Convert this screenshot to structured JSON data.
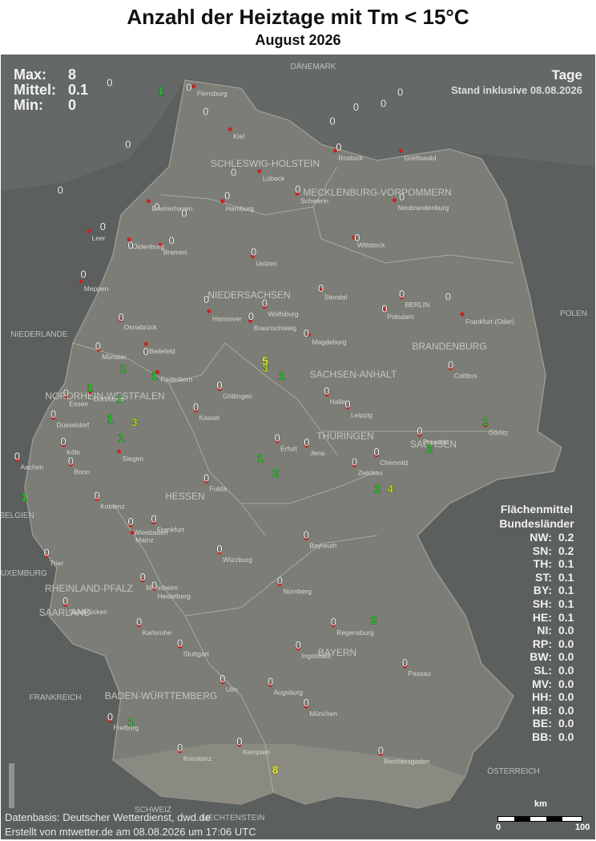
{
  "title": "Anzahl der Heiztage mit Tm < 15°C",
  "subtitle": "August 2026",
  "stats": [
    {
      "label": "Max:",
      "value": "8"
    },
    {
      "label": "Mittel:",
      "value": "0.1"
    },
    {
      "label": "Min:",
      "value": "0"
    }
  ],
  "unit": "Tage",
  "stand": "Stand inklusive 08.08.2026",
  "legend_means": {
    "heading1": "Flächenmittel",
    "heading2": "Bundesländer",
    "rows": [
      {
        "state": "NW:",
        "value": "0.2"
      },
      {
        "state": "SN:",
        "value": "0.2"
      },
      {
        "state": "TH:",
        "value": "0.1"
      },
      {
        "state": "ST:",
        "value": "0.1"
      },
      {
        "state": "BY:",
        "value": "0.1"
      },
      {
        "state": "SH:",
        "value": "0.1"
      },
      {
        "state": "HE:",
        "value": "0.1"
      },
      {
        "state": "NI:",
        "value": "0.0"
      },
      {
        "state": "RP:",
        "value": "0.0"
      },
      {
        "state": "BW:",
        "value": "0.0"
      },
      {
        "state": "SL:",
        "value": "0.0"
      },
      {
        "state": "MV:",
        "value": "0.0"
      },
      {
        "state": "HH:",
        "value": "0.0"
      },
      {
        "state": "HB:",
        "value": "0.0"
      },
      {
        "state": "BE:",
        "value": "0.0"
      },
      {
        "state": "BB:",
        "value": "0.0"
      }
    ]
  },
  "footer": {
    "source": "Datenbasis: Deutscher Wetterdienst, dwd.de",
    "created": "Erstellt von mtwetter.de am 08.08.2026 um 17:06 UTC"
  },
  "scalebar": {
    "unit": "km",
    "start": "0",
    "end": "100"
  },
  "colors": {
    "value_zero": "#ffffff",
    "value_low": "#22cc22",
    "value_mid": "#aadd22",
    "value_high": "#eeee22",
    "city_dot": "#cc2222"
  },
  "region_labels": [
    "SCHLESWIG-HOLSTEIN",
    "MECKLENBURG-VORPOMMERN",
    "NIEDERSACHSEN",
    "BRANDENBURG",
    "SACHSEN-ANHALT",
    "NORDRHEIN-WESTFALEN",
    "THÜRINGEN",
    "SACHSEN",
    "HESSEN",
    "RHEINLAND-PFALZ",
    "SAARLAND",
    "BAYERN",
    "BADEN-WÜRTTEMBERG"
  ],
  "country_labels": [
    "DÄNEMARK",
    "POLEN",
    "NIEDERLANDE",
    "BELGIEN",
    "LUXEMBURG",
    "FRANKREICH",
    "ÖSTERREICH",
    "SCHWEIZ",
    "LIECHTENSTEIN"
  ],
  "cities": [
    "Flensburg",
    "Kiel",
    "Lübeck",
    "Rostock",
    "Greifswald",
    "Schwerin",
    "Neubrandenburg",
    "Hamburg",
    "Bremerhaven",
    "Bremen",
    "Oldenburg",
    "Leer",
    "Uelzen",
    "Wittstock",
    "Meppen",
    "Stendal",
    "Potsdam",
    "BERLIN",
    "Frankfurt (Oder)",
    "Hannover",
    "Wolfsburg",
    "Braunschweig",
    "Magdeburg",
    "Osnabrück",
    "Münster",
    "Bielefeld",
    "Paderborn",
    "Göttingen",
    "Halle",
    "Leipzig",
    "Cottbus",
    "Dortmund",
    "Essen",
    "Düsseldorf",
    "Kassel",
    "Erfurt",
    "Jena",
    "Dresden",
    "Görlitz",
    "Chemnitz",
    "Zwickau",
    "Köln",
    "Bonn",
    "Aachen",
    "Siegen",
    "Fulda",
    "Koblenz",
    "Wiesbaden",
    "Frankfurt",
    "Mainz",
    "Würzburg",
    "Bayreuth",
    "Trier",
    "Mannheim",
    "Heidelberg",
    "Nürnberg",
    "Saarbrücken",
    "Karlsruhe",
    "Regensburg",
    "Stuttgart",
    "Ingolstadt",
    "Passau",
    "Ulm",
    "Augsburg",
    "München",
    "Freiburg",
    "Kempten",
    "Konstanz",
    "Berchtesgaden"
  ],
  "stations": [
    {
      "lon": 7.84,
      "lat": 54.78,
      "v": 0
    },
    {
      "lon": 8.81,
      "lat": 54.69,
      "v": 1
    },
    {
      "lon": 9.35,
      "lat": 54.73,
      "v": 0
    },
    {
      "lon": 13.37,
      "lat": 54.68,
      "v": 0
    },
    {
      "lon": 13.05,
      "lat": 54.56,
      "v": 0
    },
    {
      "lon": 9.67,
      "lat": 54.47,
      "v": 0
    },
    {
      "lon": 12.53,
      "lat": 54.52,
      "v": 0
    },
    {
      "lon": 12.08,
      "lat": 54.37,
      "v": 0
    },
    {
      "lon": 8.19,
      "lat": 54.12,
      "v": 0
    },
    {
      "lon": 6.9,
      "lat": 53.63,
      "v": 0
    },
    {
      "lon": 12.2,
      "lat": 54.09,
      "v": 0
    },
    {
      "lon": 13.4,
      "lat": 53.56,
      "v": 0
    },
    {
      "lon": 10.2,
      "lat": 53.82,
      "v": 0
    },
    {
      "lon": 9.26,
      "lat": 53.38,
      "v": 0
    },
    {
      "lon": 10.08,
      "lat": 53.57,
      "v": 0
    },
    {
      "lon": 8.74,
      "lat": 53.45,
      "v": 0
    },
    {
      "lon": 11.42,
      "lat": 53.64,
      "v": 0
    },
    {
      "lon": 7.71,
      "lat": 53.24,
      "v": 0
    },
    {
      "lon": 8.24,
      "lat": 53.04,
      "v": 0
    },
    {
      "lon": 9.02,
      "lat": 53.09,
      "v": 0
    },
    {
      "lon": 10.58,
      "lat": 52.97,
      "v": 0
    },
    {
      "lon": 12.55,
      "lat": 53.12,
      "v": 0
    },
    {
      "lon": 7.34,
      "lat": 52.73,
      "v": 0
    },
    {
      "lon": 11.86,
      "lat": 52.58,
      "v": 0
    },
    {
      "lon": 13.07,
      "lat": 52.36,
      "v": 0
    },
    {
      "lon": 13.4,
      "lat": 52.52,
      "v": 0
    },
    {
      "lon": 14.28,
      "lat": 52.49,
      "v": 0
    },
    {
      "lon": 9.68,
      "lat": 52.46,
      "v": 0
    },
    {
      "lon": 10.79,
      "lat": 52.42,
      "v": 0
    },
    {
      "lon": 10.53,
      "lat": 52.28,
      "v": 0
    },
    {
      "lon": 11.58,
      "lat": 52.1,
      "v": 0
    },
    {
      "lon": 8.06,
      "lat": 52.27,
      "v": 0
    },
    {
      "lon": 7.62,
      "lat": 51.96,
      "v": 0
    },
    {
      "lon": 8.53,
      "lat": 51.9,
      "v": 0
    },
    {
      "lon": 8.69,
      "lat": 51.64,
      "v": 1
    },
    {
      "lon": 8.1,
      "lat": 51.72,
      "v": 1
    },
    {
      "lon": 10.8,
      "lat": 51.8,
      "v": 5
    },
    {
      "lon": 10.8,
      "lat": 51.72,
      "v": 3
    },
    {
      "lon": 11.12,
      "lat": 51.64,
      "v": 1
    },
    {
      "lon": 9.93,
      "lat": 51.54,
      "v": 0
    },
    {
      "lon": 11.97,
      "lat": 51.48,
      "v": 0
    },
    {
      "lon": 12.37,
      "lat": 51.34,
      "v": 0
    },
    {
      "lon": 14.33,
      "lat": 51.76,
      "v": 0
    },
    {
      "lon": 7.47,
      "lat": 51.51,
      "v": 1
    },
    {
      "lon": 7.01,
      "lat": 51.46,
      "v": 0
    },
    {
      "lon": 8.02,
      "lat": 51.39,
      "v": 1
    },
    {
      "lon": 6.77,
      "lat": 51.23,
      "v": 0
    },
    {
      "lon": 7.85,
      "lat": 51.18,
      "v": 1
    },
    {
      "lon": 8.31,
      "lat": 51.14,
      "v": 3
    },
    {
      "lon": 9.48,
      "lat": 51.31,
      "v": 0
    },
    {
      "lon": 8.06,
      "lat": 50.98,
      "v": 1
    },
    {
      "lon": 11.03,
      "lat": 50.98,
      "v": 0
    },
    {
      "lon": 11.59,
      "lat": 50.93,
      "v": 0
    },
    {
      "lon": 10.7,
      "lat": 50.76,
      "v": 1
    },
    {
      "lon": 11.0,
      "lat": 50.6,
      "v": 2
    },
    {
      "lon": 13.74,
      "lat": 51.05,
      "v": 0
    },
    {
      "lon": 14.99,
      "lat": 51.15,
      "v": 1
    },
    {
      "lon": 13.93,
      "lat": 50.86,
      "v": 2
    },
    {
      "lon": 12.92,
      "lat": 50.83,
      "v": 0
    },
    {
      "lon": 12.5,
      "lat": 50.72,
      "v": 0
    },
    {
      "lon": 12.93,
      "lat": 50.43,
      "v": 2
    },
    {
      "lon": 13.18,
      "lat": 50.43,
      "v": 4
    },
    {
      "lon": 6.96,
      "lat": 50.94,
      "v": 0
    },
    {
      "lon": 7.1,
      "lat": 50.73,
      "v": 0
    },
    {
      "lon": 6.08,
      "lat": 50.78,
      "v": 0
    },
    {
      "lon": 6.21,
      "lat": 50.34,
      "v": 1
    },
    {
      "lon": 9.68,
      "lat": 50.55,
      "v": 0
    },
    {
      "lon": 7.6,
      "lat": 50.36,
      "v": 0
    },
    {
      "lon": 8.24,
      "lat": 50.08,
      "v": 0
    },
    {
      "lon": 8.68,
      "lat": 50.11,
      "v": 0
    },
    {
      "lon": 9.93,
      "lat": 49.79,
      "v": 0
    },
    {
      "lon": 11.58,
      "lat": 49.94,
      "v": 0
    },
    {
      "lon": 6.64,
      "lat": 49.75,
      "v": 0
    },
    {
      "lon": 8.47,
      "lat": 49.49,
      "v": 0
    },
    {
      "lon": 8.69,
      "lat": 49.4,
      "v": 0
    },
    {
      "lon": 11.08,
      "lat": 49.45,
      "v": 0
    },
    {
      "lon": 7.0,
      "lat": 49.23,
      "v": 0
    },
    {
      "lon": 8.4,
      "lat": 49.01,
      "v": 0
    },
    {
      "lon": 12.1,
      "lat": 49.01,
      "v": 0
    },
    {
      "lon": 12.86,
      "lat": 49.02,
      "v": 2
    },
    {
      "lon": 9.18,
      "lat": 48.78,
      "v": 0
    },
    {
      "lon": 11.43,
      "lat": 48.76,
      "v": 0
    },
    {
      "lon": 13.46,
      "lat": 48.57,
      "v": 0
    },
    {
      "lon": 9.99,
      "lat": 48.4,
      "v": 0
    },
    {
      "lon": 10.9,
      "lat": 48.37,
      "v": 0
    },
    {
      "lon": 11.58,
      "lat": 48.14,
      "v": 0
    },
    {
      "lon": 7.85,
      "lat": 47.99,
      "v": 0
    },
    {
      "lon": 8.25,
      "lat": 47.93,
      "v": 1
    },
    {
      "lon": 10.31,
      "lat": 47.73,
      "v": 0
    },
    {
      "lon": 9.18,
      "lat": 47.66,
      "v": 0
    },
    {
      "lon": 13.0,
      "lat": 47.63,
      "v": 0
    },
    {
      "lon": 10.99,
      "lat": 47.42,
      "v": 8
    }
  ]
}
